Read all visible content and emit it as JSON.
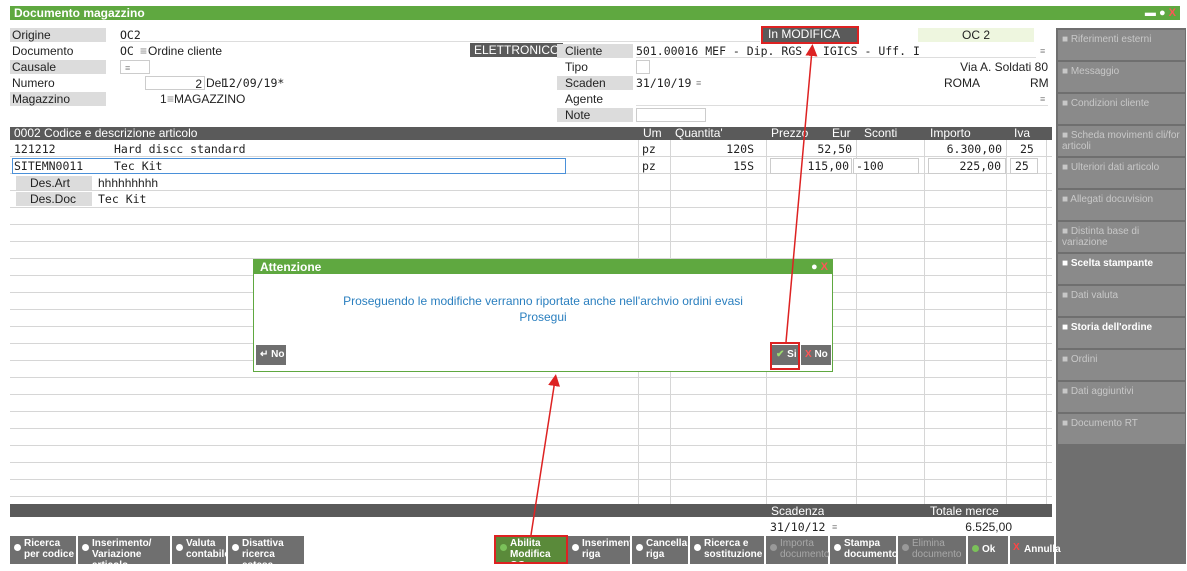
{
  "window": {
    "title": "Documento magazzino"
  },
  "header": {
    "origine_label": "Origine",
    "origine_value": "OC2",
    "documento_label": "Documento",
    "documento_code": "OC",
    "documento_desc": "Ordine cliente",
    "elettronico": "ELETTRONICO",
    "causale_label": "Causale",
    "numero_label": "Numero",
    "numero_value": "2",
    "del_label": "Del",
    "del_value": "12/09/19*",
    "magazzino_label": "Magazzino",
    "magazzino_value": "1",
    "magazzino_desc": "MAGAZZINO",
    "status": "In MODIFICA",
    "doc_ref": "OC 2",
    "cliente_label": "Cliente",
    "cliente_value": "501.00016 MEF - Dip. RGS - IGICS - Uff. I",
    "tipo_label": "Tipo",
    "address": "Via A. Soldati 80",
    "scaden_label": "Scaden",
    "scaden_value": "31/10/19",
    "city": "ROMA",
    "province": "RM",
    "agente_label": "Agente",
    "note_label": "Note"
  },
  "grid": {
    "h_code": "0002  Codice e descrizione articolo",
    "h_um": "Um",
    "h_qta": "Quantita'",
    "h_prezzo": "Prezzo",
    "h_eur": "Eur",
    "h_sconti": "Sconti",
    "h_importo": "Importo",
    "h_iva": "Iva",
    "rows": [
      {
        "code": "121212",
        "desc": "Hard discc standard",
        "um": "pz",
        "qta": "120S",
        "prezzo": "52,50",
        "sconti": "",
        "importo": "6.300,00",
        "iva": "25"
      },
      {
        "code": "SITEMN0011",
        "desc": "Tec Kit",
        "um": "pz",
        "qta": "15S",
        "prezzo": "115,00",
        "sconti": "-100",
        "importo": "225,00",
        "iva": "25"
      }
    ],
    "desart_label": "Des.Art",
    "desart_value": "hhhhhhhhh",
    "desdoc_label": "Des.Doc",
    "desdoc_value": "Tec Kit"
  },
  "footer": {
    "scadenza_label": "Scadenza",
    "scadenza_value": "31/10/12",
    "totale_label": "Totale merce",
    "totale_value": "6.525,00"
  },
  "sidebar": [
    {
      "label": "Riferimenti esterni",
      "enabled": false
    },
    {
      "label": "Messaggio",
      "enabled": false
    },
    {
      "label": "Condizioni cliente",
      "enabled": false
    },
    {
      "label": "Scheda movimenti cli/for articoli",
      "enabled": false
    },
    {
      "label": "Ulteriori dati articolo",
      "enabled": false
    },
    {
      "label": "Allegati docuvision",
      "enabled": false
    },
    {
      "label": "Distinta base di variazione",
      "enabled": false
    },
    {
      "label": "Scelta stampante",
      "enabled": true
    },
    {
      "label": "Dati valuta",
      "enabled": false
    },
    {
      "label": "Storia dell'ordine",
      "enabled": true
    },
    {
      "label": "Ordini",
      "enabled": false
    },
    {
      "label": "Dati aggiuntivi",
      "enabled": false
    },
    {
      "label": "Documento RT",
      "enabled": false
    }
  ],
  "bottom": [
    {
      "l1": "Ricerca",
      "l2": "per codice"
    },
    {
      "l1": "Inserimento/",
      "l2": "Variazione articolo"
    },
    {
      "l1": "Valuta",
      "l2": "contabile"
    },
    {
      "l1": "Disattiva",
      "l2": "ricerca estesa"
    },
    {
      "l1": "Abilita",
      "l2": "Modifica OC"
    },
    {
      "l1": "Inserimento",
      "l2": "riga"
    },
    {
      "l1": "Cancella",
      "l2": "riga"
    },
    {
      "l1": "Ricerca e",
      "l2": "sostituzione"
    },
    {
      "l1": "Importa",
      "l2": "documento"
    },
    {
      "l1": "Stampa",
      "l2": "documento"
    },
    {
      "l1": "Elimina",
      "l2": "documento"
    },
    {
      "l1": "Ok",
      "l2": ""
    },
    {
      "l1": "Annulla",
      "l2": ""
    }
  ],
  "dialog": {
    "title": "Attenzione",
    "message": "Proseguendo le modifiche verranno riportate anche nell'archvio ordini evasi",
    "question": "Prosegui",
    "no_left": "No",
    "si": "Si",
    "no_right": "No"
  },
  "colors": {
    "accent": "#5fa840",
    "annotation": "#dd2222",
    "link": "#2a7fbf"
  }
}
